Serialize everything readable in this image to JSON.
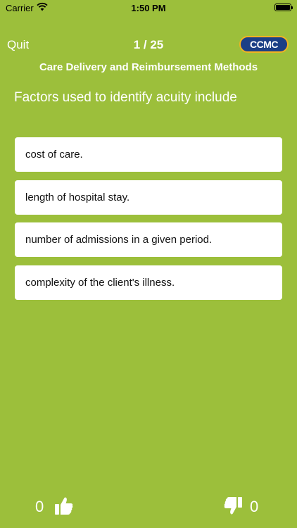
{
  "status_bar": {
    "carrier": "Carrier",
    "time": "1:50 PM"
  },
  "header": {
    "quit_label": "Quit",
    "counter": "1 / 25",
    "logo_text": "CCMC"
  },
  "category": "Care Delivery and Reimbursement Methods",
  "question": "Factors used to identify acuity include",
  "answers": [
    "cost of care.",
    "length of hospital stay.",
    "number of admissions in a given period.",
    "complexity of the client's illness."
  ],
  "votes": {
    "likes": "0",
    "dislikes": "0"
  },
  "icons": {
    "like": "thumbs-up-icon",
    "dislike": "thumbs-down-icon",
    "wifi": "wifi-icon",
    "battery": "battery-icon"
  },
  "colors": {
    "background": "#9cbf3b",
    "logo_fill": "#1b3f86",
    "logo_border": "#f3b321"
  }
}
